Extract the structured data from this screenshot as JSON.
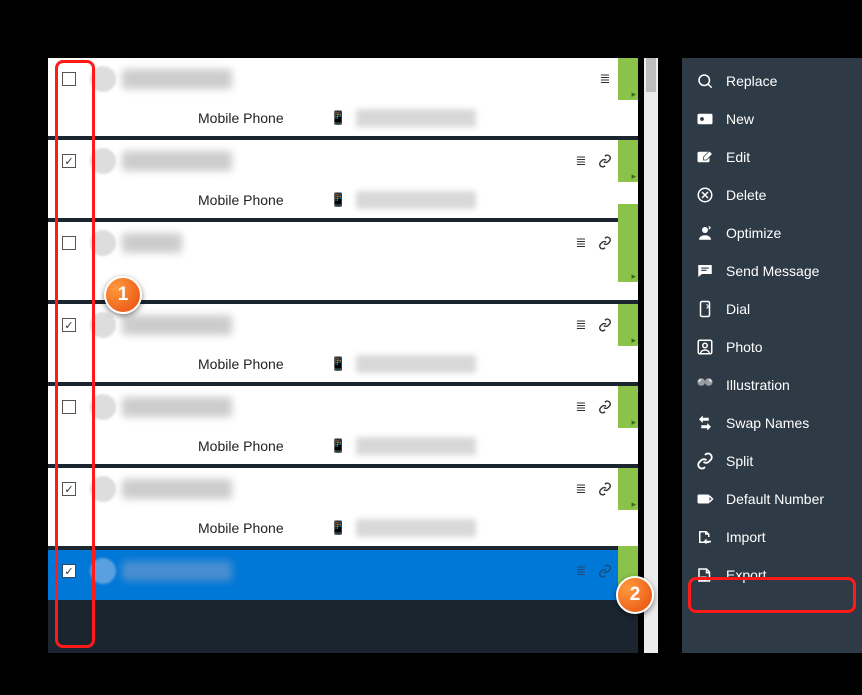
{
  "contacts": [
    {
      "checked": false,
      "phone_label": "Mobile Phone",
      "has_phone": true,
      "has_link": false
    },
    {
      "checked": true,
      "phone_label": "Mobile Phone",
      "has_phone": true,
      "has_link": true
    },
    {
      "checked": false,
      "phone_label": "",
      "has_phone": false,
      "has_link": true
    },
    {
      "checked": true,
      "phone_label": "Mobile Phone",
      "has_phone": true,
      "has_link": true
    },
    {
      "checked": false,
      "phone_label": "Mobile Phone",
      "has_phone": true,
      "has_link": true
    },
    {
      "checked": true,
      "phone_label": "Mobile Phone",
      "has_phone": true,
      "has_link": true
    },
    {
      "checked": true,
      "phone_label": "",
      "has_phone": false,
      "has_link": true,
      "selected": true
    }
  ],
  "sidebar": {
    "items": [
      {
        "label": "Replace",
        "icon": "replace"
      },
      {
        "label": "New",
        "icon": "new"
      },
      {
        "label": "Edit",
        "icon": "edit"
      },
      {
        "label": "Delete",
        "icon": "delete"
      },
      {
        "label": "Optimize",
        "icon": "optimize"
      },
      {
        "label": "Send Message",
        "icon": "send-message"
      },
      {
        "label": "Dial",
        "icon": "dial"
      },
      {
        "label": "Photo",
        "icon": "photo"
      },
      {
        "label": "Illustration",
        "icon": "illustration"
      },
      {
        "label": "Swap Names",
        "icon": "swap-names"
      },
      {
        "label": "Split",
        "icon": "split"
      },
      {
        "label": "Default Number",
        "icon": "default-number"
      },
      {
        "label": "Import",
        "icon": "import"
      },
      {
        "label": "Export",
        "icon": "export"
      }
    ]
  },
  "badges": {
    "one": "1",
    "two": "2"
  },
  "checkmark": "✓",
  "list_glyph": "≣"
}
